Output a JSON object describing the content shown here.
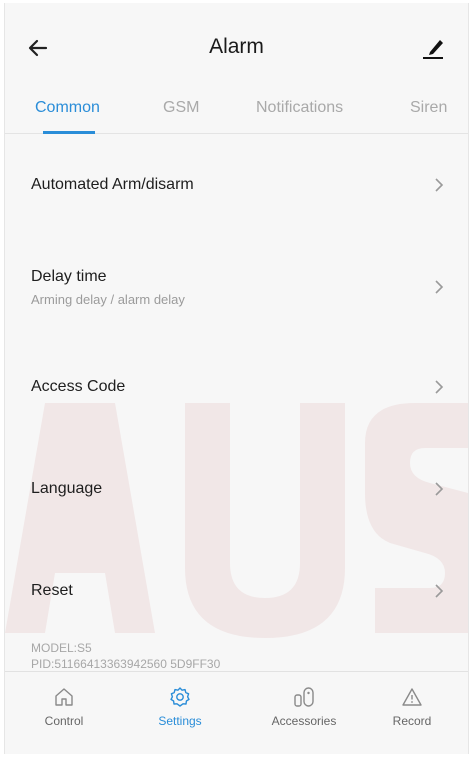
{
  "header": {
    "title": "Alarm"
  },
  "tabs": [
    {
      "label": "Common",
      "active": true
    },
    {
      "label": "GSM",
      "active": false
    },
    {
      "label": "Notifications",
      "active": false
    },
    {
      "label": "Siren",
      "active": false
    }
  ],
  "list": {
    "items": [
      {
        "label": "Automated Arm/disarm",
        "sub": ""
      },
      {
        "label": "Delay time",
        "sub": "Arming delay / alarm delay"
      },
      {
        "label": "Access Code",
        "sub": ""
      },
      {
        "label": "Language",
        "sub": ""
      },
      {
        "label": "Reset",
        "sub": ""
      }
    ]
  },
  "device": {
    "model": "MODEL:S5",
    "pid": "PID:51166413363942560 5D9FF30"
  },
  "bottom_nav": {
    "items": [
      {
        "label": "Control",
        "icon": "home-icon",
        "active": false
      },
      {
        "label": "Settings",
        "icon": "gear-icon",
        "active": true
      },
      {
        "label": "Accessories",
        "icon": "accessories-icon",
        "active": false
      },
      {
        "label": "Record",
        "icon": "warning-icon",
        "active": false
      }
    ]
  },
  "colors": {
    "accent": "#2a8dd8",
    "background": "#f7f7f7",
    "text": "#1e1e1e",
    "muted": "#9b9b9b"
  }
}
